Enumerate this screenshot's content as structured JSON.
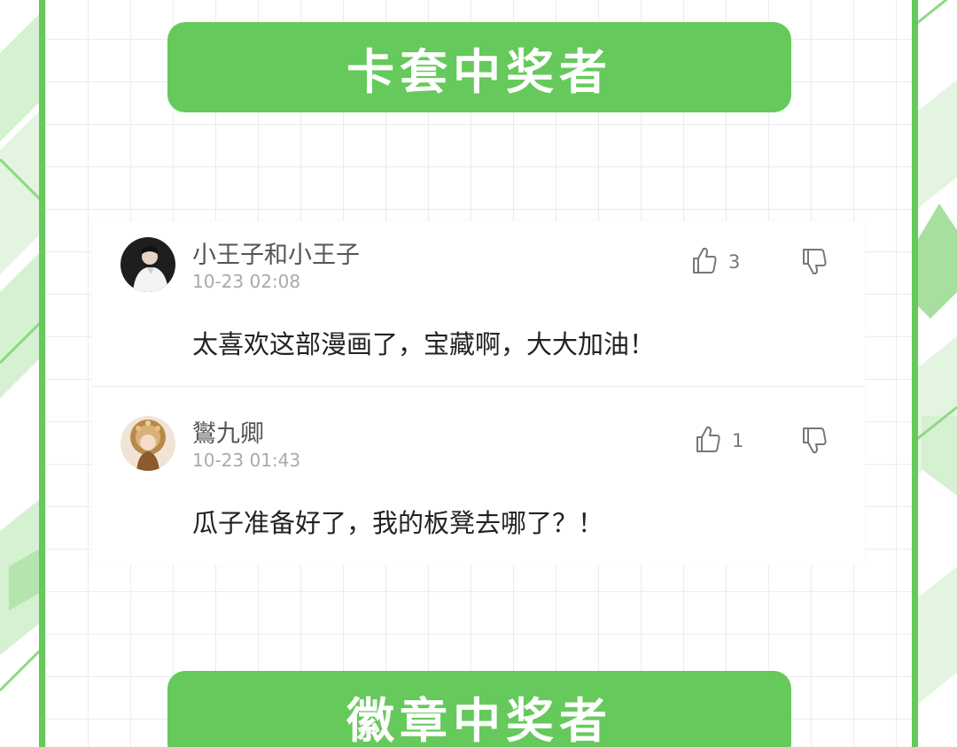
{
  "banners": {
    "top_title": "卡套中奖者",
    "bottom_title": "徽章中奖者"
  },
  "theme": {
    "accent": "#66c95b",
    "deco_light": "#c9ecc4"
  },
  "comments": [
    {
      "username": "小王子和小王子",
      "timestamp": "10-23 02:08",
      "text": "太喜欢这部漫画了，宝藏啊，大大加油！",
      "likes": "3",
      "avatar": "avatar-photo-man-white-shirt"
    },
    {
      "username": "鸑九卿",
      "timestamp": "10-23 01:43",
      "text": "瓜子准备好了，我的板凳去哪了？！",
      "likes": "1",
      "avatar": "avatar-illustration-golden-headdress"
    }
  ],
  "icons": {
    "like": "thumbs-up-icon",
    "dislike": "thumbs-down-icon"
  }
}
